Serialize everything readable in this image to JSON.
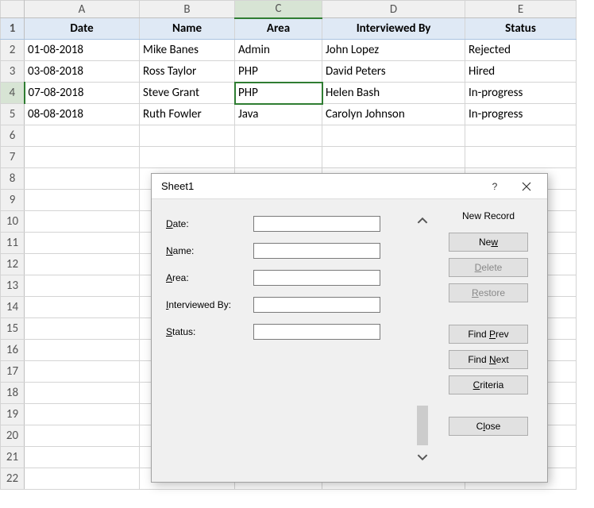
{
  "columns": [
    "A",
    "B",
    "C",
    "D",
    "E"
  ],
  "headers": {
    "A": "Date",
    "B": "Name",
    "C": "Area",
    "D": "Interviewed By",
    "E": "Status"
  },
  "rows": [
    {
      "A": "01-08-2018",
      "B": "Mike Banes",
      "C": "Admin",
      "D": "John Lopez",
      "E": "Rejected"
    },
    {
      "A": "03-08-2018",
      "B": "Ross Taylor",
      "C": "PHP",
      "D": "David Peters",
      "E": "Hired"
    },
    {
      "A": "07-08-2018",
      "B": "Steve Grant",
      "C": "PHP",
      "D": "Helen Bash",
      "E": "In-progress"
    },
    {
      "A": "08-08-2018",
      "B": "Ruth Fowler",
      "C": "Java",
      "D": "Carolyn Johnson",
      "E": "In-progress"
    }
  ],
  "row_numbers": [
    "1",
    "2",
    "3",
    "4",
    "5",
    "6",
    "7",
    "8",
    "9",
    "10",
    "11",
    "12",
    "13",
    "14",
    "15",
    "16",
    "17",
    "18",
    "19",
    "20",
    "21",
    "22"
  ],
  "active_cell": "C4",
  "dialog": {
    "title": "Sheet1",
    "status": "New Record",
    "fields": [
      {
        "label_pre": "",
        "ul": "D",
        "label_post": "ate:",
        "value": ""
      },
      {
        "label_pre": "",
        "ul": "N",
        "label_post": "ame:",
        "value": ""
      },
      {
        "label_pre": "",
        "ul": "A",
        "label_post": "rea:",
        "value": ""
      },
      {
        "label_pre": "",
        "ul": "I",
        "label_post": "nterviewed By:",
        "value": ""
      },
      {
        "label_pre": "",
        "ul": "S",
        "label_post": "tatus:",
        "value": ""
      }
    ],
    "buttons": {
      "new": {
        "pre": "Ne",
        "ul": "w",
        "post": ""
      },
      "delete": {
        "pre": "",
        "ul": "D",
        "post": "elete"
      },
      "restore": {
        "pre": "",
        "ul": "R",
        "post": "estore"
      },
      "find_prev": {
        "pre": "Find ",
        "ul": "P",
        "post": "rev"
      },
      "find_next": {
        "pre": "Find ",
        "ul": "N",
        "post": "ext"
      },
      "criteria": {
        "pre": "",
        "ul": "C",
        "post": "riteria"
      },
      "close": {
        "pre": "C",
        "ul": "l",
        "post": "ose"
      }
    }
  }
}
